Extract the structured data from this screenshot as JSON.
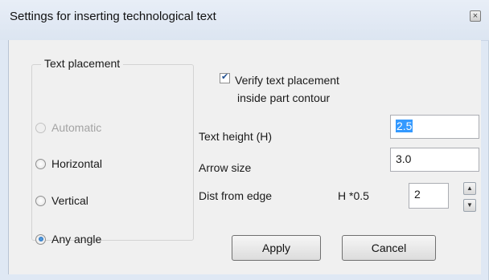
{
  "window": {
    "title": "Settings for inserting technological text",
    "close_glyph": "×"
  },
  "placement": {
    "legend": "Text placement",
    "options": [
      {
        "label": "Automatic",
        "checked": false,
        "disabled": true
      },
      {
        "label": "Horizontal",
        "checked": false,
        "disabled": false
      },
      {
        "label": "Vertical",
        "checked": false,
        "disabled": false
      },
      {
        "label": "Any angle",
        "checked": true,
        "disabled": false
      }
    ]
  },
  "verify": {
    "line1": "Verify text placement",
    "line2": "inside part contour",
    "checked": true
  },
  "fields": {
    "text_height_label": "Text height (H)",
    "text_height_value": "2.5",
    "arrow_size_label": "Arrow size",
    "arrow_size_value": "3.0",
    "dist_label": "Dist from edge",
    "dist_multiplier": "H *0.5",
    "dist_value": "2",
    "spin_up": "▲",
    "spin_down": "▼"
  },
  "buttons": {
    "apply": "Apply",
    "cancel": "Cancel"
  },
  "colors": {
    "frame": "#dfe8f4",
    "panel": "#f0f0f0",
    "selection": "#3399ff"
  }
}
